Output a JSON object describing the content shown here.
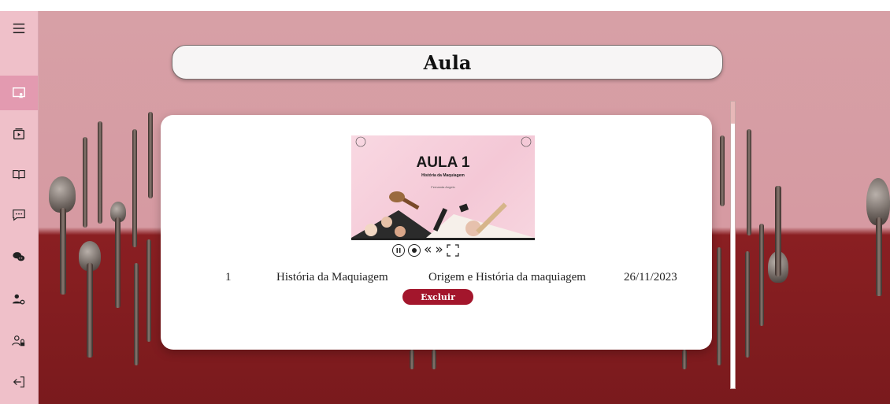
{
  "page": {
    "title": "Aula"
  },
  "sidebar": {
    "items": [
      {
        "icon": "menu-icon"
      },
      {
        "icon": "classroom-icon",
        "active": true
      },
      {
        "icon": "video-player-icon"
      },
      {
        "icon": "book-icon"
      },
      {
        "icon": "chat-icon"
      },
      {
        "icon": "chat-bubbles-icon"
      },
      {
        "icon": "user-settings-icon"
      },
      {
        "icon": "user-lock-icon"
      },
      {
        "icon": "logout-icon"
      }
    ]
  },
  "lesson": {
    "thumbnail": {
      "title": "AULA 1",
      "subtitle": "História da Maquiagem",
      "author": "Fernanda Angelo"
    },
    "number": "1",
    "name": "História da Maquiagem",
    "description": "Origem e História da maquiagem",
    "date": "26/11/2023",
    "delete_label": "Excluir"
  },
  "player_controls": {
    "pause": "pause-icon",
    "stop": "stop-icon",
    "rewind": "rewind-icon",
    "forward": "forward-icon",
    "fullscreen": "fullscreen-icon"
  },
  "colors": {
    "sidebar_bg": "#efc0c9",
    "sidebar_active": "#e39ab0",
    "accent_button": "#a3162c"
  }
}
